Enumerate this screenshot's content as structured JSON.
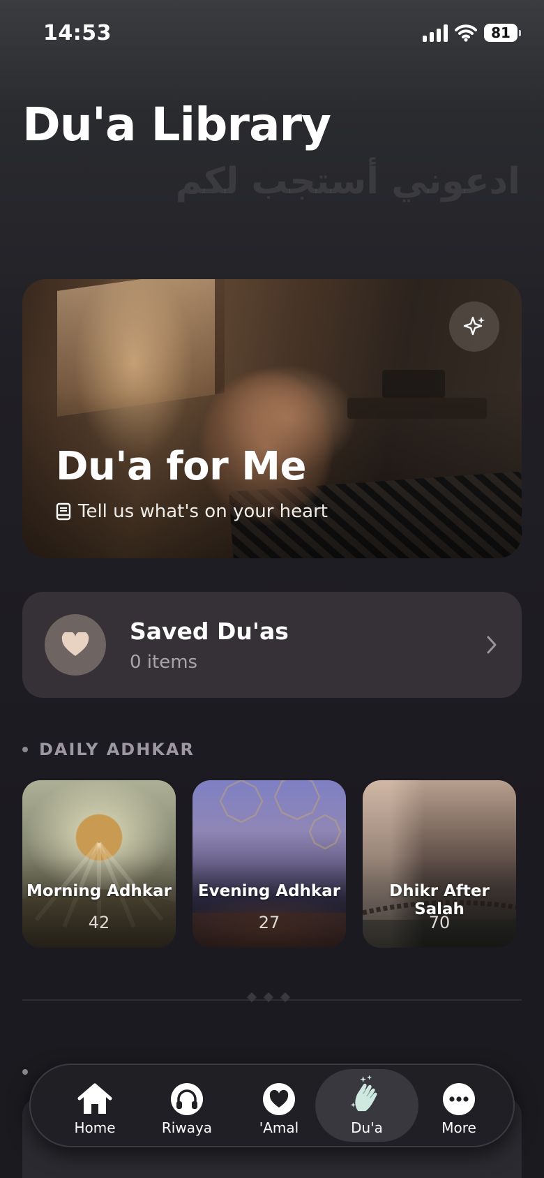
{
  "status_bar": {
    "time": "14:53",
    "battery": "81"
  },
  "header": {
    "title": "Du'a Library",
    "arabic_subtitle": "ادعوني أستجب لكم"
  },
  "hero": {
    "title": "Du'a for Me",
    "subtitle": "Tell us what's on your heart",
    "icons": {
      "action": "sparkles-icon",
      "subtitle": "book-icon"
    }
  },
  "saved": {
    "title": "Saved Du'as",
    "count": "0 items",
    "icons": {
      "avatar": "heart-icon",
      "chevron": "chevron-right-icon"
    }
  },
  "daily_adhkar": {
    "heading": "DAILY ADHKAR",
    "items": [
      {
        "title": "Morning Adhkar",
        "count": "42"
      },
      {
        "title": "Evening Adhkar",
        "count": "27"
      },
      {
        "title": "Dhikr After Salah",
        "count": "70"
      }
    ]
  },
  "tab_bar": {
    "active": "Du'a",
    "items": [
      {
        "label": "Home",
        "icon": "home-icon"
      },
      {
        "label": "Riwaya",
        "icon": "headphones-icon"
      },
      {
        "label": "'Amal",
        "icon": "heart-icon"
      },
      {
        "label": "Du'a",
        "icon": "praying-hands-icon"
      },
      {
        "label": "More",
        "icon": "more-icon"
      }
    ]
  },
  "colors": {
    "background": "#1b1a20",
    "card": "#353136",
    "muted_text": "#a9a4a6",
    "accent_heart": "#e8d2c2",
    "dua_icon": "#cfe9e1"
  }
}
